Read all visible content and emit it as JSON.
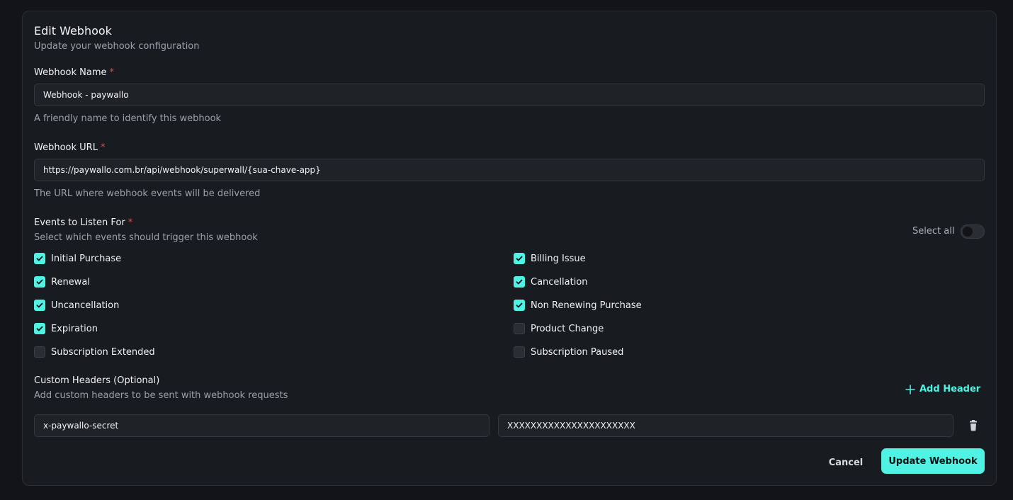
{
  "header": {
    "title": "Edit Webhook",
    "subtitle": "Update your webhook configuration"
  },
  "name_field": {
    "label": "Webhook Name",
    "required_mark": "*",
    "value": "Webhook - paywallo",
    "hint": "A friendly name to identify this webhook"
  },
  "url_field": {
    "label": "Webhook URL",
    "required_mark": "*",
    "value": "https://paywallo.com.br/api/webhook/superwall/{sua-chave-app}",
    "hint": "The URL where webhook events will be delivered"
  },
  "events": {
    "label": "Events to Listen For",
    "required_mark": "*",
    "hint": "Select which events should trigger this webhook",
    "select_all_label": "Select all",
    "select_all_on": false,
    "items": [
      {
        "label": "Initial Purchase",
        "checked": true
      },
      {
        "label": "Billing Issue",
        "checked": true
      },
      {
        "label": "Renewal",
        "checked": true
      },
      {
        "label": "Cancellation",
        "checked": true
      },
      {
        "label": "Uncancellation",
        "checked": true
      },
      {
        "label": "Non Renewing Purchase",
        "checked": true
      },
      {
        "label": "Expiration",
        "checked": true
      },
      {
        "label": "Product Change",
        "checked": false
      },
      {
        "label": "Subscription Extended",
        "checked": false
      },
      {
        "label": "Subscription Paused",
        "checked": false
      }
    ]
  },
  "headers": {
    "label": "Custom Headers (Optional)",
    "hint": "Add custom headers to be sent with webhook requests",
    "add_label": "Add Header",
    "rows": [
      {
        "key": "x-paywallo-secret",
        "value": "XXXXXXXXXXXXXXXXXXXXXX"
      }
    ]
  },
  "footer": {
    "cancel_label": "Cancel",
    "submit_label": "Update Webhook"
  },
  "colors": {
    "accent": "#4ff2e3",
    "required": "#ef4444",
    "background": "#121417",
    "card": "#181b1f"
  }
}
